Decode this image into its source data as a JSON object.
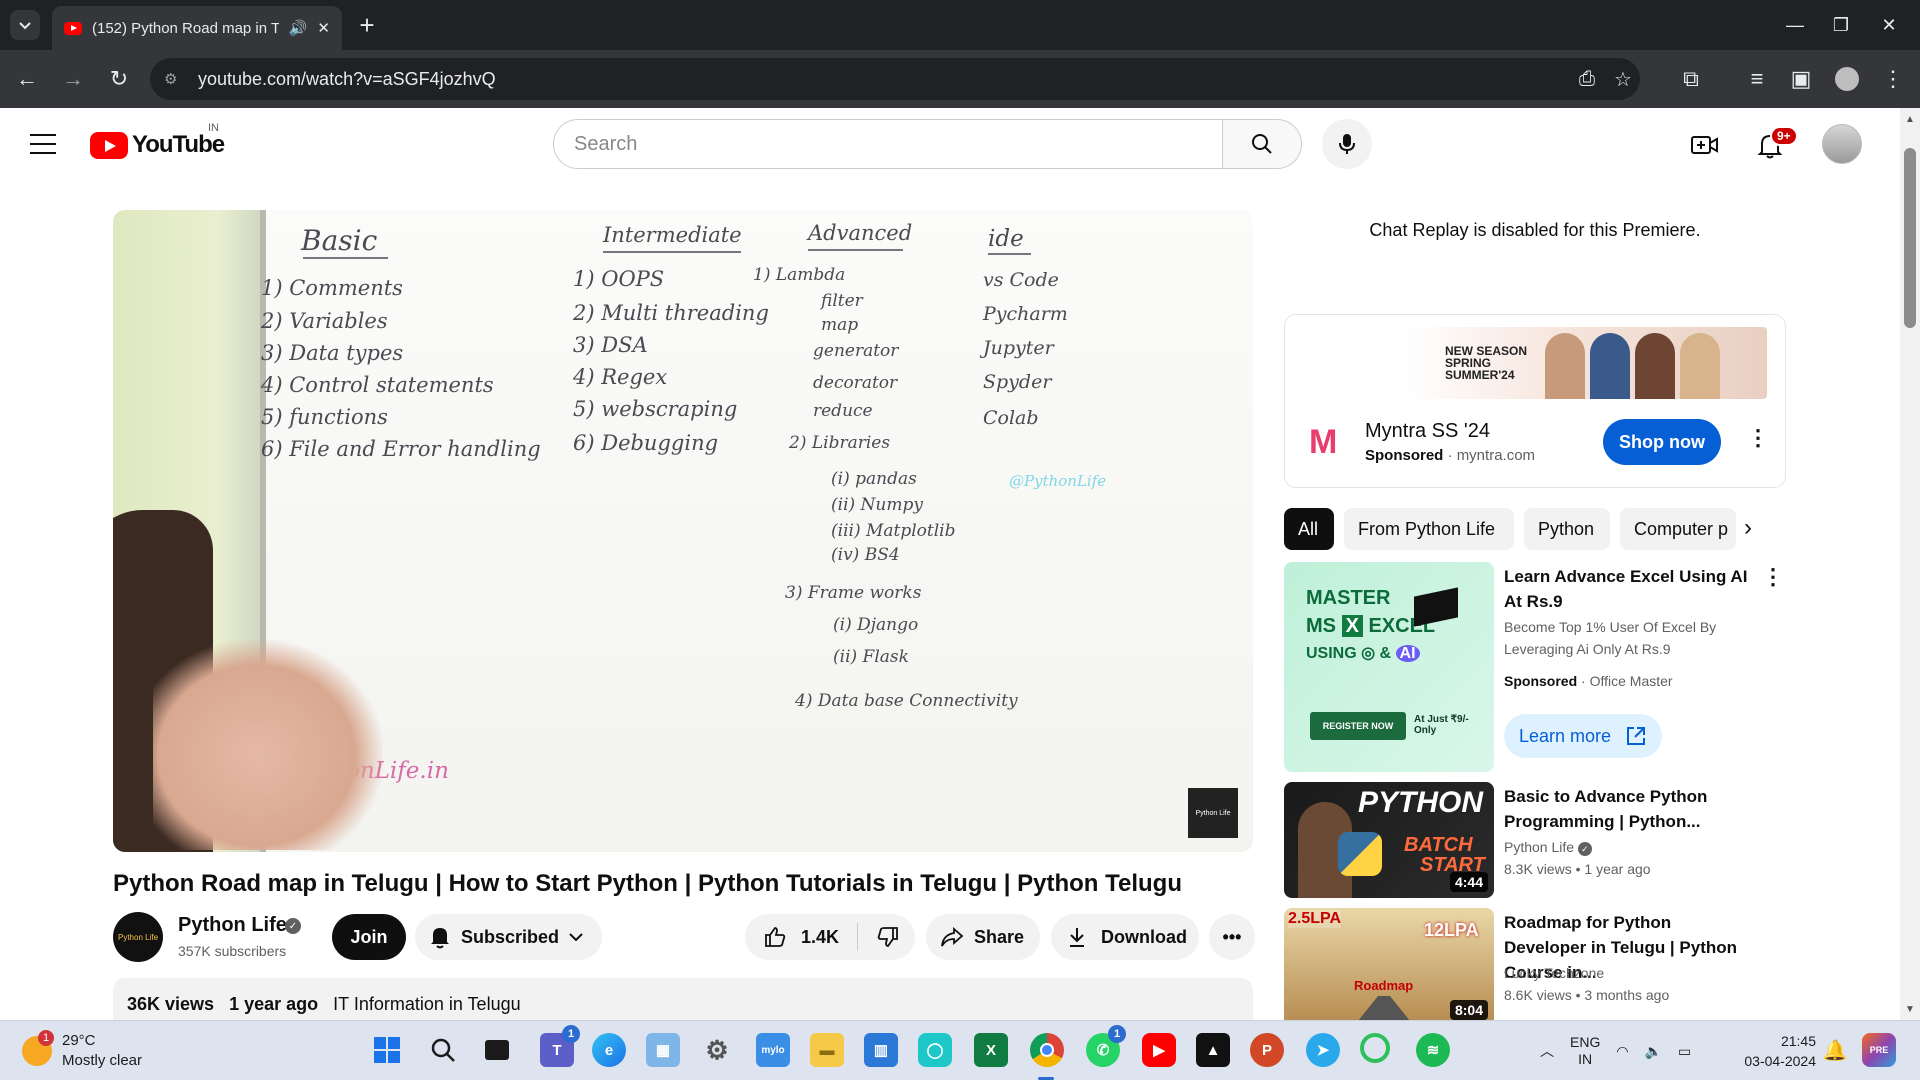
{
  "browser": {
    "tab_title": "(152) Python Road map in T",
    "address": "youtube.com/watch?v=aSGF4jozhvQ"
  },
  "youtube": {
    "logo_text": "YouTube",
    "country_code": "IN",
    "search_placeholder": "Search",
    "notifications_badge": "9+"
  },
  "video": {
    "board": {
      "basic_heading": "Basic",
      "basic_items": [
        "1) Comments",
        "2) Variables",
        "3) Data types",
        "4) Control statements",
        "5) functions",
        "6) File and Error handling"
      ],
      "intermediate_heading": "Intermediate",
      "intermediate_items": [
        "1) OOPS",
        "2) Multi threading",
        "3) DSA",
        "4) Regex",
        "5) webscraping",
        "6) Debugging"
      ],
      "advanced_heading": "Advanced",
      "advanced_items": [
        "1) Lambda",
        "filter",
        "map",
        "generator",
        "decorator",
        "reduce",
        "2) Libraries",
        "(i) pandas",
        "(ii) Numpy",
        "(iii) Matplotlib",
        "(iv) BS4",
        "3) Frame works",
        "(i) Django",
        "(ii) Flask",
        "4) Data base Connectivity"
      ],
      "ide_heading": "ide",
      "ide_items": [
        "vs Code",
        "Pycharm",
        "Jupyter",
        "Spyder",
        "Colab"
      ],
      "handle": "@PythonLife",
      "site": "onLife.in"
    },
    "title": "Python Road map in Telugu | How to Start Python | Python Tutorials in Telugu | Python Telugu",
    "channel": {
      "name": "Python Life",
      "subscribers": "357K subscribers",
      "avatar_text": "Python Life"
    },
    "buttons": {
      "join": "Join",
      "subscribed": "Subscribed",
      "likes": "1.4K",
      "share": "Share",
      "download": "Download"
    },
    "description": {
      "views": "36K views",
      "age": "1 year ago",
      "tag": "IT Information in Telugu"
    }
  },
  "sidebar": {
    "chat_replay": "Chat Replay is disabled for this Premiere.",
    "ad": {
      "banner_text": "NEW SEASON SPRING SUMMER'24",
      "title": "Myntra SS '24",
      "sponsored": "Sponsored",
      "domain": "myntra.com",
      "cta": "Shop now"
    },
    "chips": [
      "All",
      "From Python Life",
      "Python",
      "Computer p"
    ],
    "recommendations": [
      {
        "title": "Learn Advance Excel Using AI At Rs.9",
        "description": "Become Top 1% User Of Excel By Leveraging Ai Only At Rs.9",
        "sponsored": "Sponsored",
        "advertiser": "Office Master",
        "cta": "Learn more",
        "thumb_lines": [
          "MASTER",
          "MS",
          "EXCEL",
          "USING",
          "&",
          "REGISTER NOW",
          "At Just ₹9/- Only"
        ]
      },
      {
        "title": "Basic to Advance Python Programming | Python...",
        "channel": "Python Life",
        "views": "8.3K views",
        "age": "1 year ago",
        "duration": "4:44",
        "thumb_lines": [
          "PYTHON",
          "BATCH",
          "START"
        ]
      },
      {
        "title": "Roadmap for Python Developer in Telugu | Python Course in...",
        "channel": "Lucky Techzone",
        "views": "8.6K views",
        "age": "3 months ago",
        "duration": "8:04",
        "thumb_lines": [
          "2.5LPA",
          "12LPA",
          "Roadmap"
        ]
      }
    ]
  },
  "taskbar": {
    "weather_temp": "29°C",
    "weather_desc": "Mostly clear",
    "weather_badge": "1",
    "teams_badge": "1",
    "whatsapp_badge": "1",
    "lang_top": "ENG",
    "lang_bottom": "IN",
    "time": "21:45",
    "date": "03-04-2024"
  },
  "colors": {
    "youtube_red": "#ff0000",
    "link_blue": "#065fd4",
    "chrome_dark": "#202124",
    "marker_dark": "#4a4a52",
    "marker_cyan": "#7fd6e8",
    "marker_pink": "#d86aa8"
  }
}
